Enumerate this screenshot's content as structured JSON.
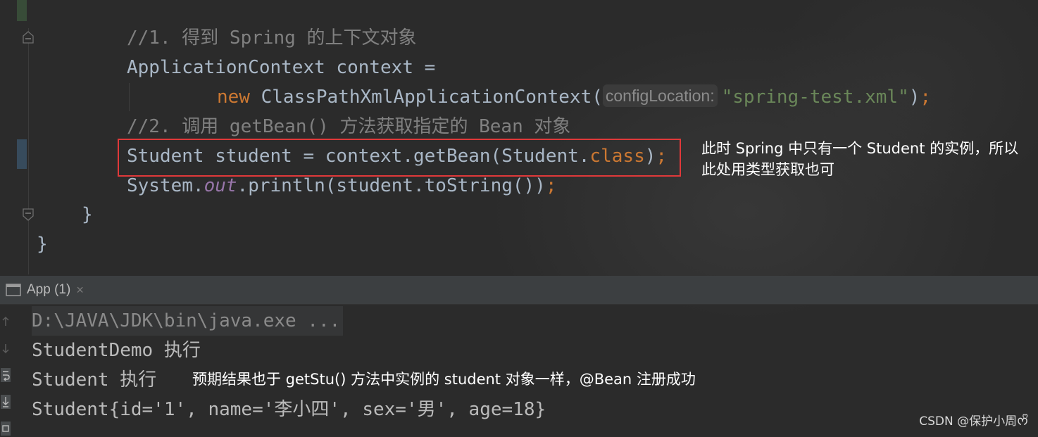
{
  "editor": {
    "lines": {
      "comment1": "//1. 得到 Spring 的上下文对象",
      "line2": "ApplicationContext context =",
      "line3_new": "new",
      "line3_class": "ClassPathXmlApplicationContext(",
      "line3_hint": "configLocation:",
      "line3_string": "\"spring-test.xml\"",
      "line3_close": ")",
      "line3_semi": ";",
      "comment2": "//2. 调用 getBean() 方法获取指定的 Bean 对象",
      "line5_a": "Student student = context.getBean(Student.",
      "line5_kw": "class",
      "line5_close": ")",
      "line5_semi": ";",
      "line6_a": "System.",
      "line6_field": "out",
      "line6_b": ".println(student.toString())",
      "line6_semi": ";",
      "line7": "}",
      "line8": "}"
    },
    "annotation": "此时 Spring 中只有一个 Student 的实例，所以\n此处用类型获取也可"
  },
  "run_panel": {
    "tab_label": "App (1)",
    "close_glyph": "×",
    "console": {
      "cmd": "D:\\JAVA\\JDK\\bin\\java.exe ...",
      "out1": "StudentDemo 执行",
      "out2": "Student 执行",
      "out3": "Student{id='1', name='李小四', sex='男', age=18}"
    },
    "annotation": "预期结果也于 getStu() 方法中实例的 student 对象一样，@Bean 注册成功"
  },
  "watermark": "CSDN @保护小周ᰔᩚ",
  "colors": {
    "background": "#2b2b2b",
    "keyword": "#cc7832",
    "string": "#6a8759",
    "comment": "#808080",
    "field": "#9876aa",
    "highlight_border": "#e0393a"
  },
  "icons": [
    "fold-icon",
    "console-window-icon",
    "close-icon",
    "up-arrow-icon",
    "down-arrow-icon",
    "soft-wrap-icon",
    "scroll-to-end-icon",
    "print-icon"
  ]
}
